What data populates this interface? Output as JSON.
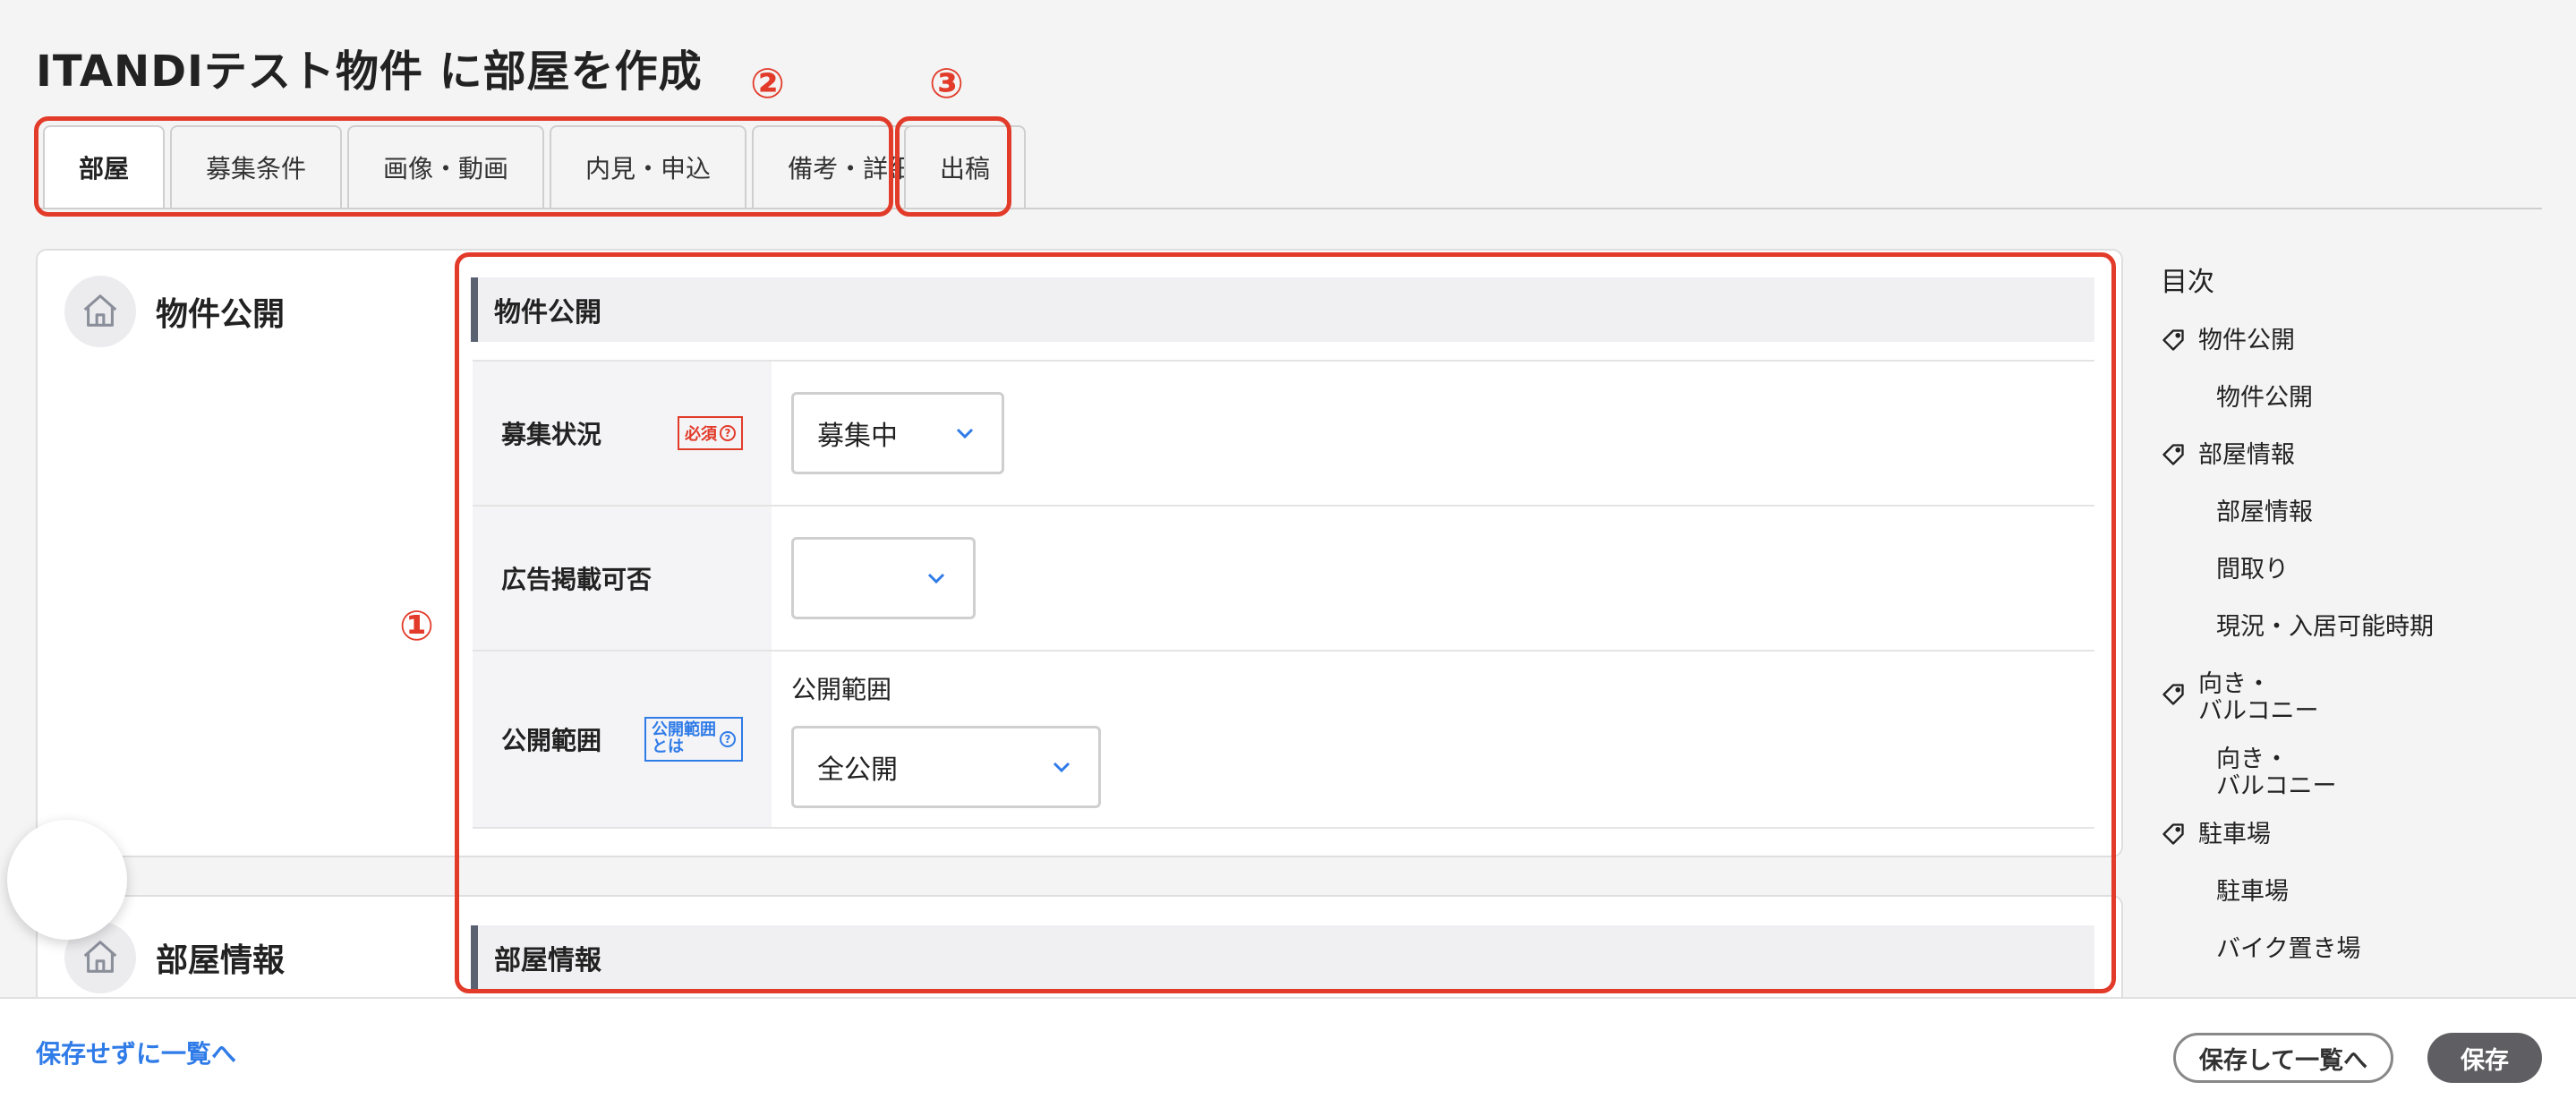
{
  "page": {
    "title": "ITANDIテスト物件 に部屋を作成"
  },
  "tabs": [
    {
      "label": "部屋"
    },
    {
      "label": "募集条件"
    },
    {
      "label": "画像・動画"
    },
    {
      "label": "内見・申込"
    },
    {
      "label": "備考・詳細"
    }
  ],
  "publish_tab": {
    "label": "出稿"
  },
  "annotations": {
    "one": "①",
    "two": "②",
    "three": "③"
  },
  "sections": {
    "publish": {
      "title": "物件公開",
      "form_title": "物件公開",
      "rows": {
        "status": {
          "label": "募集状況",
          "badge": "必須",
          "value": "募集中"
        },
        "ad": {
          "label": "広告掲載可否",
          "value": ""
        },
        "scope": {
          "label": "公開範囲",
          "badge_line1": "公開範囲",
          "badge_line2": "とは",
          "sub_label": "公開範囲",
          "value": "全公開"
        }
      }
    },
    "room": {
      "title": "部屋情報",
      "form_title": "部屋情報"
    }
  },
  "toc": {
    "title": "目次",
    "items": [
      {
        "label": "物件公開",
        "level": 1,
        "icon": "tag-icon"
      },
      {
        "label": "物件公開",
        "level": 2
      },
      {
        "label": "部屋情報",
        "level": 1,
        "icon": "tag-icon"
      },
      {
        "label": "部屋情報",
        "level": 2
      },
      {
        "label": "間取り",
        "level": 2
      },
      {
        "label": "現況・入居可能時期",
        "level": 2
      },
      {
        "label": "向き・",
        "label2": "バルコニー",
        "level": 1,
        "icon": "tag-icon"
      },
      {
        "label": "向き・",
        "label2": "バルコニー",
        "level": 2
      },
      {
        "label": "駐車場",
        "level": 1,
        "icon": "tag-icon"
      },
      {
        "label": "駐車場",
        "level": 2
      },
      {
        "label": "バイク置き場",
        "level": 2
      }
    ]
  },
  "footer": {
    "back_link": "保存せずに一覧へ",
    "save_and_list": "保存して一覧へ",
    "save": "保存"
  },
  "colors": {
    "annotation": "#e23b2a",
    "link": "#2f7be8",
    "accent_bar": "#5a6272"
  }
}
